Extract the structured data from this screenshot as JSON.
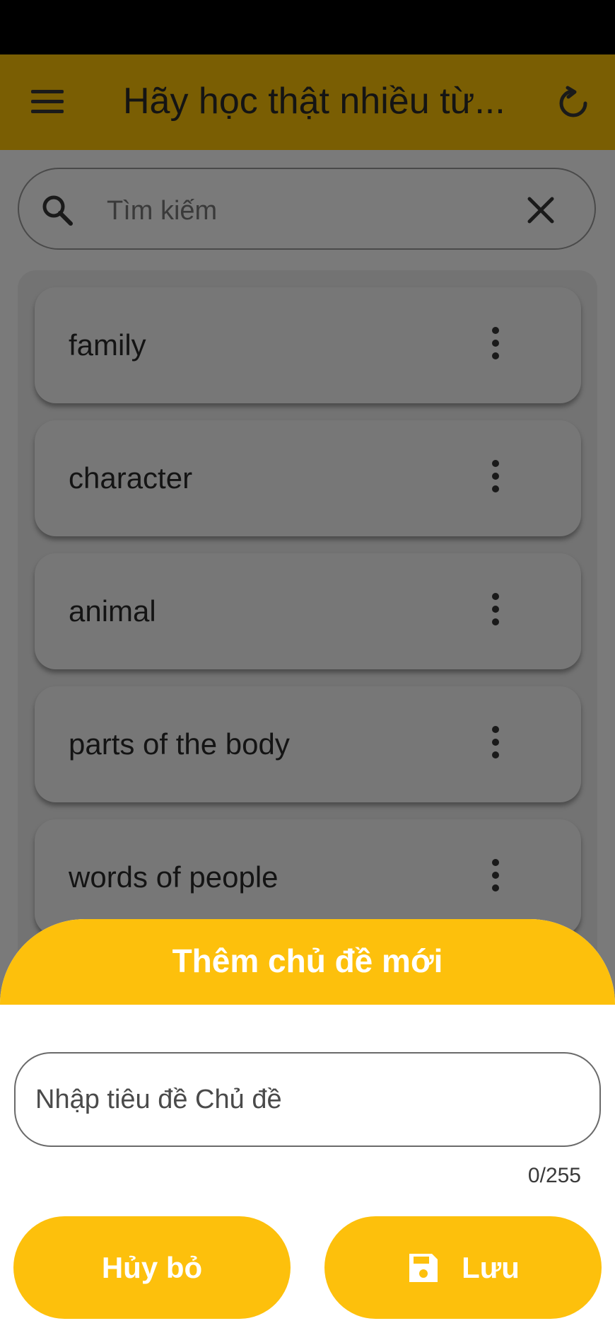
{
  "app_bar": {
    "title": "Hãy học thật nhiều từ...",
    "background": "#7a5e03"
  },
  "search": {
    "placeholder": "Tìm kiếm"
  },
  "topics": [
    {
      "label": "family"
    },
    {
      "label": "character"
    },
    {
      "label": "animal"
    },
    {
      "label": "parts of the body"
    },
    {
      "label": "words of people"
    }
  ],
  "sheet": {
    "title": "Thêm chủ đề mới",
    "input_placeholder": "Nhập tiêu đề Chủ đề",
    "counter": "0/255",
    "cancel_label": "Hủy bỏ",
    "save_label": "Lưu",
    "accent": "#fdc00c"
  },
  "icons": [
    "menu-icon",
    "refresh-icon",
    "search-icon",
    "close-icon",
    "more-vert-icon",
    "save-icon"
  ]
}
